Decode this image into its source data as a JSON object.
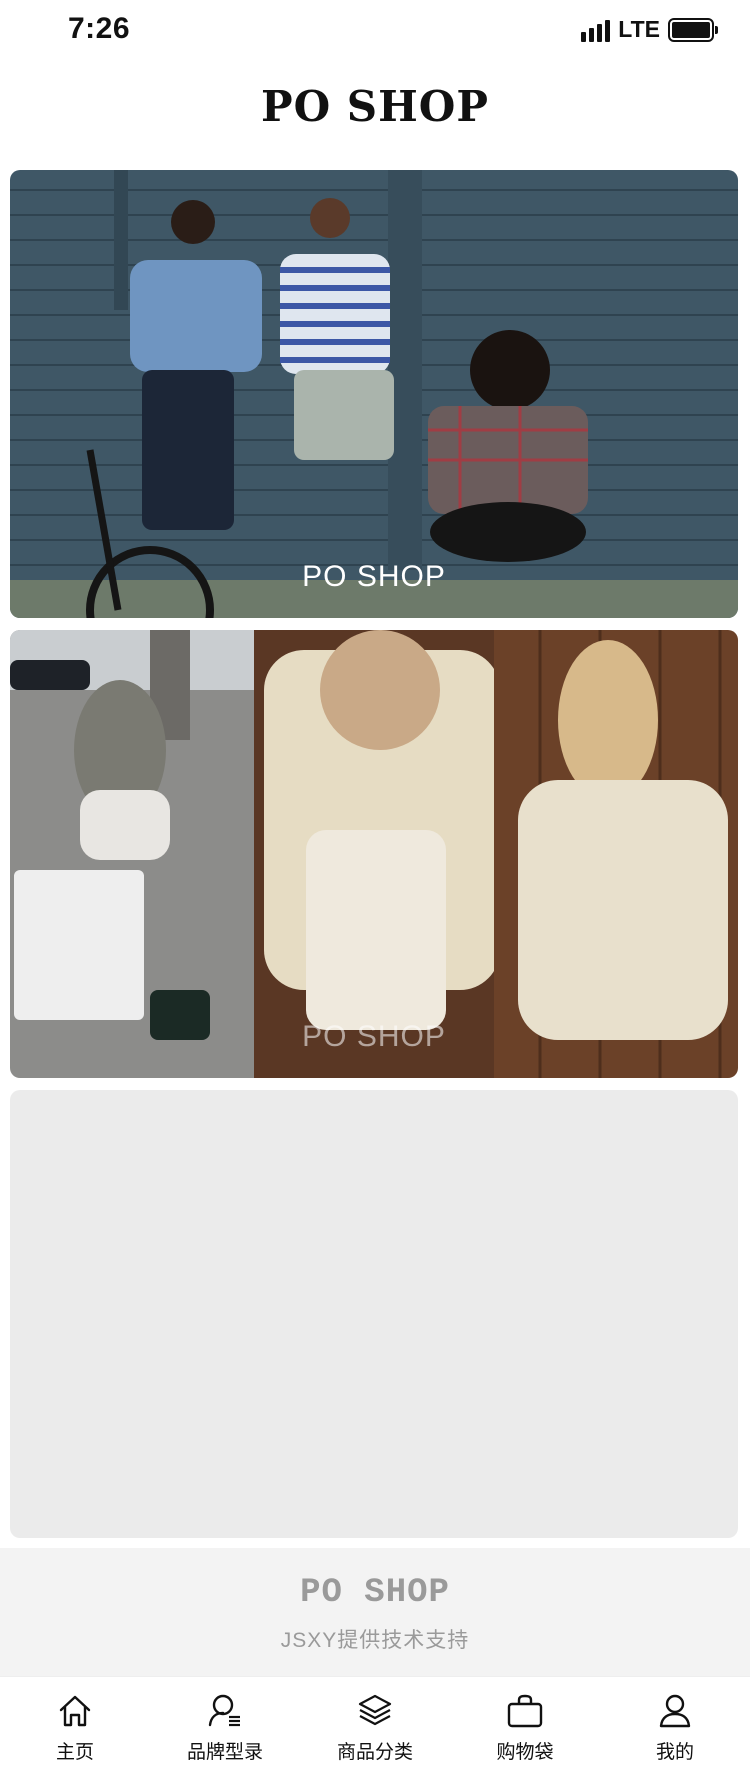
{
  "status_bar": {
    "time": "7:26",
    "network": "LTE"
  },
  "header": {
    "title": "PO SHOP"
  },
  "banners": [
    {
      "caption": "PO SHOP"
    },
    {
      "caption": "PO SHOP"
    },
    {
      "caption": ""
    }
  ],
  "footer": {
    "brand": "PO SHOP",
    "credit": "JSXY提供技术支持"
  },
  "tab_bar": {
    "items": [
      {
        "label": "主页",
        "icon": "home-icon"
      },
      {
        "label": "品牌型录",
        "icon": "brand-catalog-icon"
      },
      {
        "label": "商品分类",
        "icon": "layers-icon"
      },
      {
        "label": "购物袋",
        "icon": "shopping-bag-icon"
      },
      {
        "label": "我的",
        "icon": "user-icon"
      }
    ]
  }
}
